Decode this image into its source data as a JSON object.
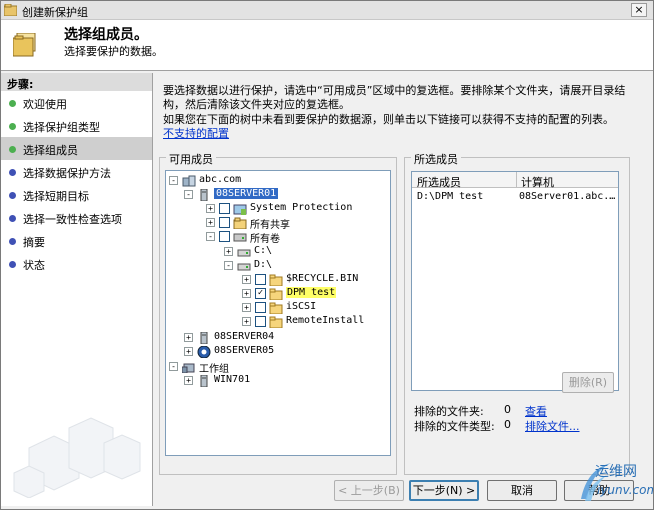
{
  "window": {
    "title": "创建新保护组",
    "close_label": "×"
  },
  "header": {
    "title": "选择组成员。",
    "subtitle": "选择要保护的数据。"
  },
  "steps": {
    "heading": "步骤:",
    "items": [
      {
        "label": "欢迎使用",
        "color": "#4caf50"
      },
      {
        "label": "选择保护组类型",
        "color": "#4caf50"
      },
      {
        "label": "选择组成员",
        "color": "#4caf50"
      },
      {
        "label": "选择数据保护方法",
        "color": "#3f51b5"
      },
      {
        "label": "选择短期目标",
        "color": "#3f51b5"
      },
      {
        "label": "选择一致性检查选项",
        "color": "#3f51b5"
      },
      {
        "label": "摘要",
        "color": "#3f51b5"
      },
      {
        "label": "状态",
        "color": "#3f51b5"
      }
    ]
  },
  "description": {
    "line1": "要选择数据以进行保护，请选中“可用成员”区域中的复选框。要排除某个文件夹，请展开目录结构，然后清除该文件夹对应的复选框。",
    "line2": "如果您在下面的树中未看到要保护的数据源，则单击以下链接可以获得不支持的配置的列表。",
    "link": "不支持的配置"
  },
  "available": {
    "label": "可用成员",
    "tree": [
      {
        "label": "abc.com",
        "icon": "domain-icon"
      },
      {
        "label": "08SERVER01",
        "icon": "server-icon"
      },
      {
        "label": "System Protection",
        "icon": "system-protection-icon"
      },
      {
        "label": "所有共享",
        "icon": "share-icon"
      },
      {
        "label": "所有卷",
        "icon": "volumes-icon"
      },
      {
        "label": "C:\\",
        "icon": "drive-icon"
      },
      {
        "label": "D:\\",
        "icon": "drive-icon"
      },
      {
        "label": "$RECYCLE.BIN",
        "icon": "folder-icon"
      },
      {
        "label": "DPM test",
        "icon": "folder-icon"
      },
      {
        "label": "iSCSI",
        "icon": "folder-icon"
      },
      {
        "label": "RemoteInstall",
        "icon": "folder-icon"
      },
      {
        "label": "08SERVER04",
        "icon": "server-icon"
      },
      {
        "label": "08SERVER05",
        "icon": "dpm-server-icon"
      },
      {
        "label": "工作组",
        "icon": "workgroup-icon"
      },
      {
        "label": "WIN701",
        "icon": "server-icon"
      }
    ]
  },
  "selected": {
    "label": "所选成员",
    "columns": [
      "所选成员",
      "计算机"
    ],
    "rows": [
      {
        "member": "D:\\DPM test",
        "computer": "08Server01.abc.…"
      }
    ],
    "remove_label": "删除(R)",
    "excluded_folders_label": "排除的文件夹:",
    "excluded_folders_count": "0",
    "excluded_folders_link": "查看",
    "excluded_types_label": "排除的文件类型:",
    "excluded_types_count": "0",
    "excluded_types_link": "排除文件..."
  },
  "buttons": {
    "back": "< 上一步(B)",
    "next": "下一步(N) >",
    "cancel": "取消",
    "help": "帮助"
  },
  "watermark": {
    "line1": "运维网",
    "line2": "iyunv.com"
  }
}
